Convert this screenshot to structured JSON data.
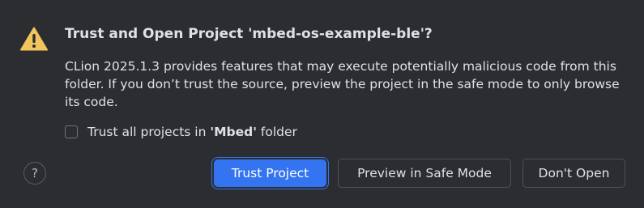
{
  "dialog": {
    "title": "Trust and Open Project 'mbed-os-example-ble'?",
    "message": "CLion 2025.1.3 provides features that may execute potentially malicious code from this folder. If you don’t trust the source, preview the project in the safe mode to only browse its code.",
    "checkbox": {
      "prefix": "Trust all projects in ",
      "folder": "'Mbed'",
      "suffix": " folder",
      "checked": false
    },
    "help_label": "?",
    "buttons": {
      "trust": "Trust Project",
      "preview": "Preview in Safe Mode",
      "dont_open": "Don't Open"
    }
  },
  "icons": {
    "warning": "warning-triangle-icon",
    "help": "help-icon"
  },
  "colors": {
    "background": "#2b2d30",
    "accent": "#3574f0",
    "warning": "#f2c55c",
    "text": "#dfe1e5"
  }
}
